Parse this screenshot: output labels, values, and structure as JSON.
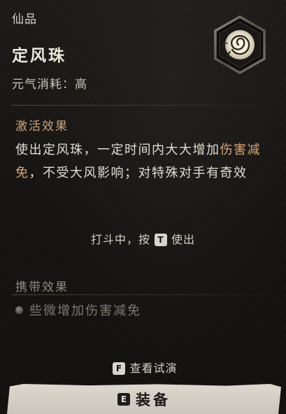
{
  "header": {
    "category": "仙品",
    "item_name": "定风珠",
    "cost_label": "元气消耗：",
    "cost_value": "高",
    "emblem_icon": "wind-spiral-icon"
  },
  "active": {
    "title": "激活效果",
    "desc_part1": "使出定风珠，一定时间内大大增加",
    "desc_highlight": "伤害减免",
    "desc_part2": "，不受大风影响；对特殊对手有奇效",
    "hint_prefix": "打斗中，按",
    "hint_key": "T",
    "hint_suffix": "使出"
  },
  "carry": {
    "title": "携带效果",
    "item": "些微增加伤害减免"
  },
  "footer": {
    "preview_key": "F",
    "preview_label": "查看试演",
    "equip_key": "E",
    "equip_label": "装备"
  },
  "colors": {
    "accent_title": "#c9a27a",
    "highlight_text": "#d2a877",
    "equip_bar": "#d8d3c8"
  }
}
